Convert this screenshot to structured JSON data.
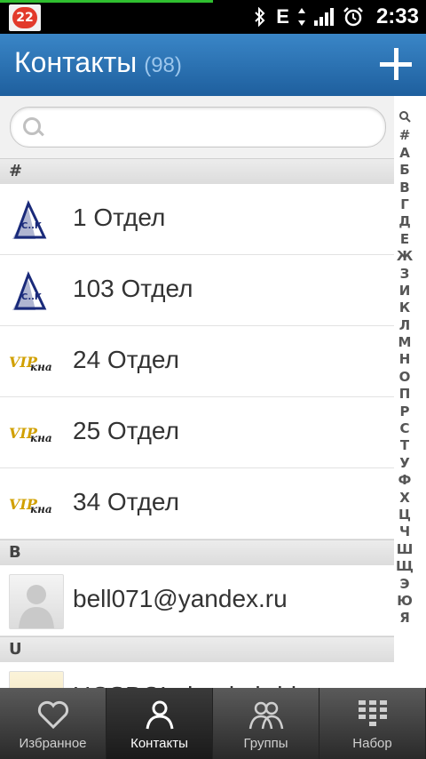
{
  "statusbar": {
    "notification_count": "22",
    "network_label": "E",
    "time": "2:33"
  },
  "header": {
    "title": "Контакты",
    "count": "(98)"
  },
  "search": {
    "placeholder": ""
  },
  "sections": [
    {
      "letter": "#",
      "contacts": [
        {
          "name": "1 Отдел",
          "avatar": "triangle-logo"
        },
        {
          "name": "103 Отдел",
          "avatar": "triangle-logo"
        },
        {
          "name": "24 Отдел",
          "avatar": "vip-logo"
        },
        {
          "name": "25 Отдел",
          "avatar": "vip-logo"
        },
        {
          "name": "34 Отдел",
          "avatar": "vip-logo"
        }
      ]
    },
    {
      "letter": "B",
      "contacts": [
        {
          "name": "bell071@yandex.ru",
          "avatar": "default-person"
        }
      ]
    },
    {
      "letter": "U",
      "contacts": [
        {
          "name": "UCSBC!...bool...bridge",
          "avatar": "photo"
        }
      ]
    }
  ],
  "logo_text": {
    "triangle": "С..К",
    "vip_main": "VIP",
    "vip_sub": "кна"
  },
  "index_letters": [
    "#",
    "А",
    "Б",
    "В",
    "Г",
    "Д",
    "Е",
    "Ж",
    "З",
    "И",
    "К",
    "Л",
    "М",
    "Н",
    "О",
    "П",
    "Р",
    "С",
    "Т",
    "У",
    "Ф",
    "Х",
    "Ц",
    "Ч",
    "Ш",
    "Щ",
    "Э",
    "Ю",
    "Я"
  ],
  "tabs": [
    {
      "label": "Избранное",
      "icon": "heart-icon",
      "active": false
    },
    {
      "label": "Контакты",
      "icon": "person-icon",
      "active": true
    },
    {
      "label": "Группы",
      "icon": "group-icon",
      "active": false
    },
    {
      "label": "Набор",
      "icon": "dialpad-icon",
      "active": false
    }
  ],
  "colors": {
    "header": "#2a72b5",
    "accent": "#9cc6ec",
    "badge": "#e23a2b"
  }
}
